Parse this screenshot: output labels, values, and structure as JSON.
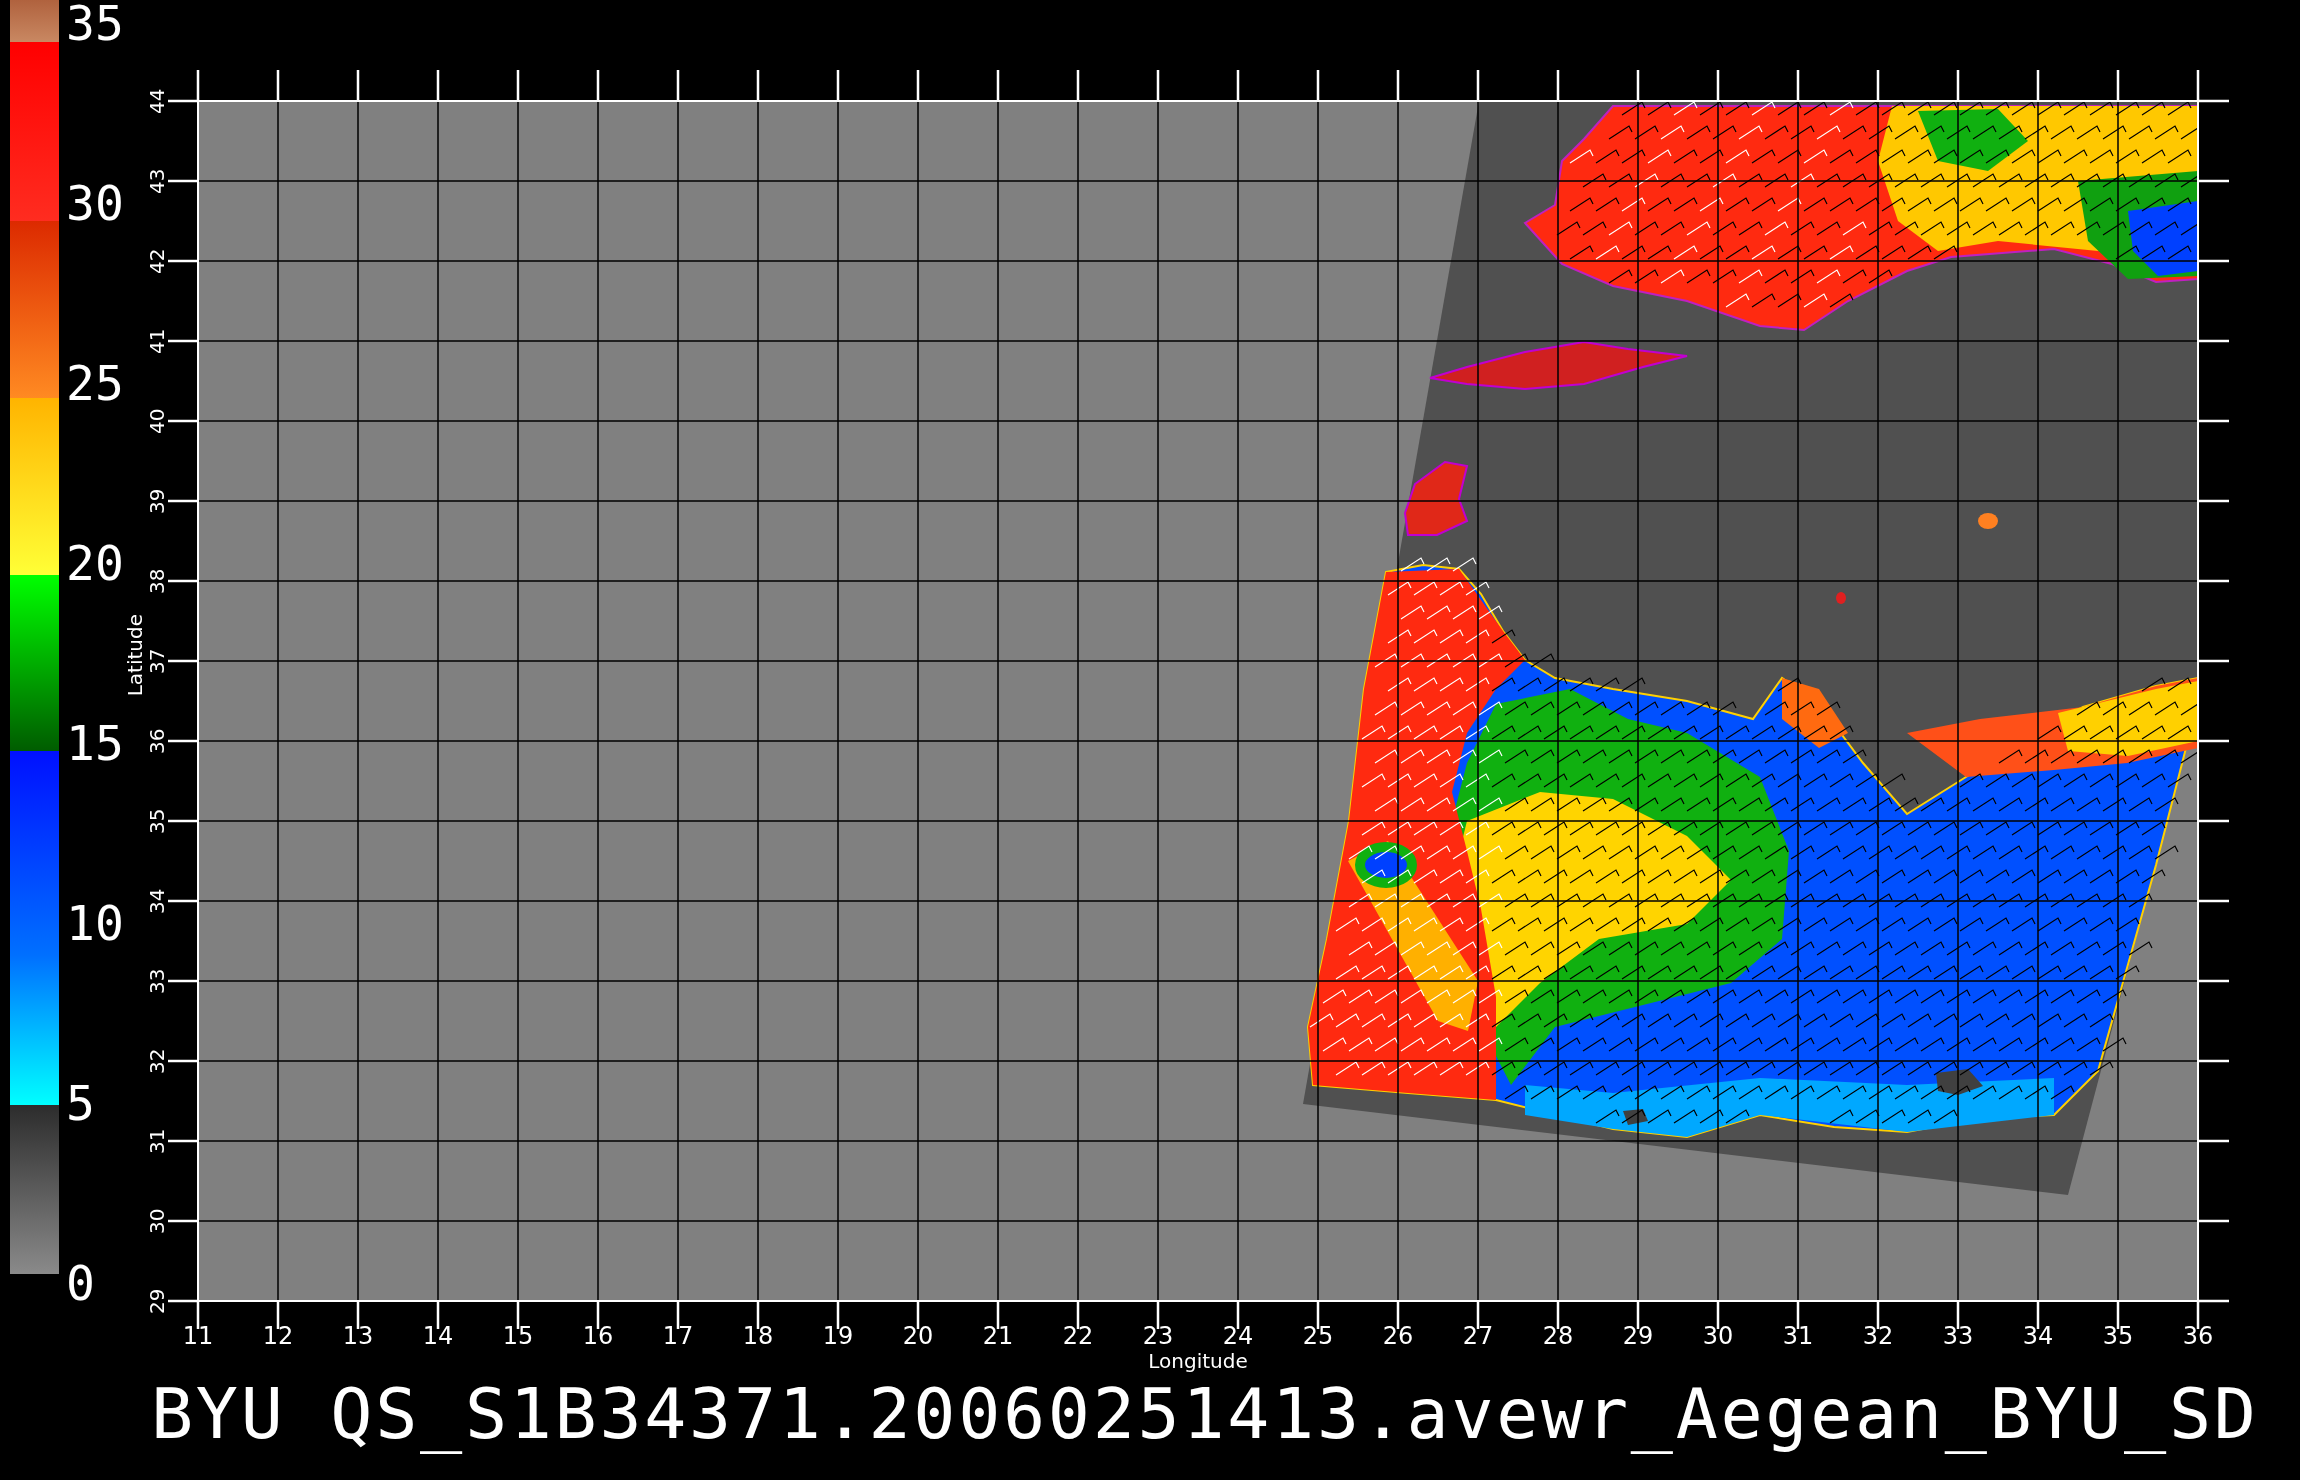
{
  "colorbar": {
    "labels": [
      "35",
      "30",
      "25",
      "20",
      "15",
      "10",
      "5",
      "0"
    ]
  },
  "map": {
    "y_axis": {
      "title": "Latitude",
      "ticks": [
        "44",
        "43",
        "42",
        "41",
        "40",
        "39",
        "38",
        "37",
        "36",
        "35",
        "34",
        "33",
        "32",
        "31",
        "30",
        "29"
      ]
    },
    "x_axis": {
      "title": "Longitude",
      "ticks": [
        "11",
        "12",
        "13",
        "14",
        "15",
        "16",
        "17",
        "18",
        "19",
        "20",
        "21",
        "22",
        "23",
        "24",
        "25",
        "26",
        "27",
        "28",
        "29",
        "30",
        "31",
        "32",
        "33",
        "34",
        "35",
        "36"
      ]
    }
  },
  "title": "BYU QS_S1B34371.20060251413.avewr_Aegean_BYU_SD"
}
